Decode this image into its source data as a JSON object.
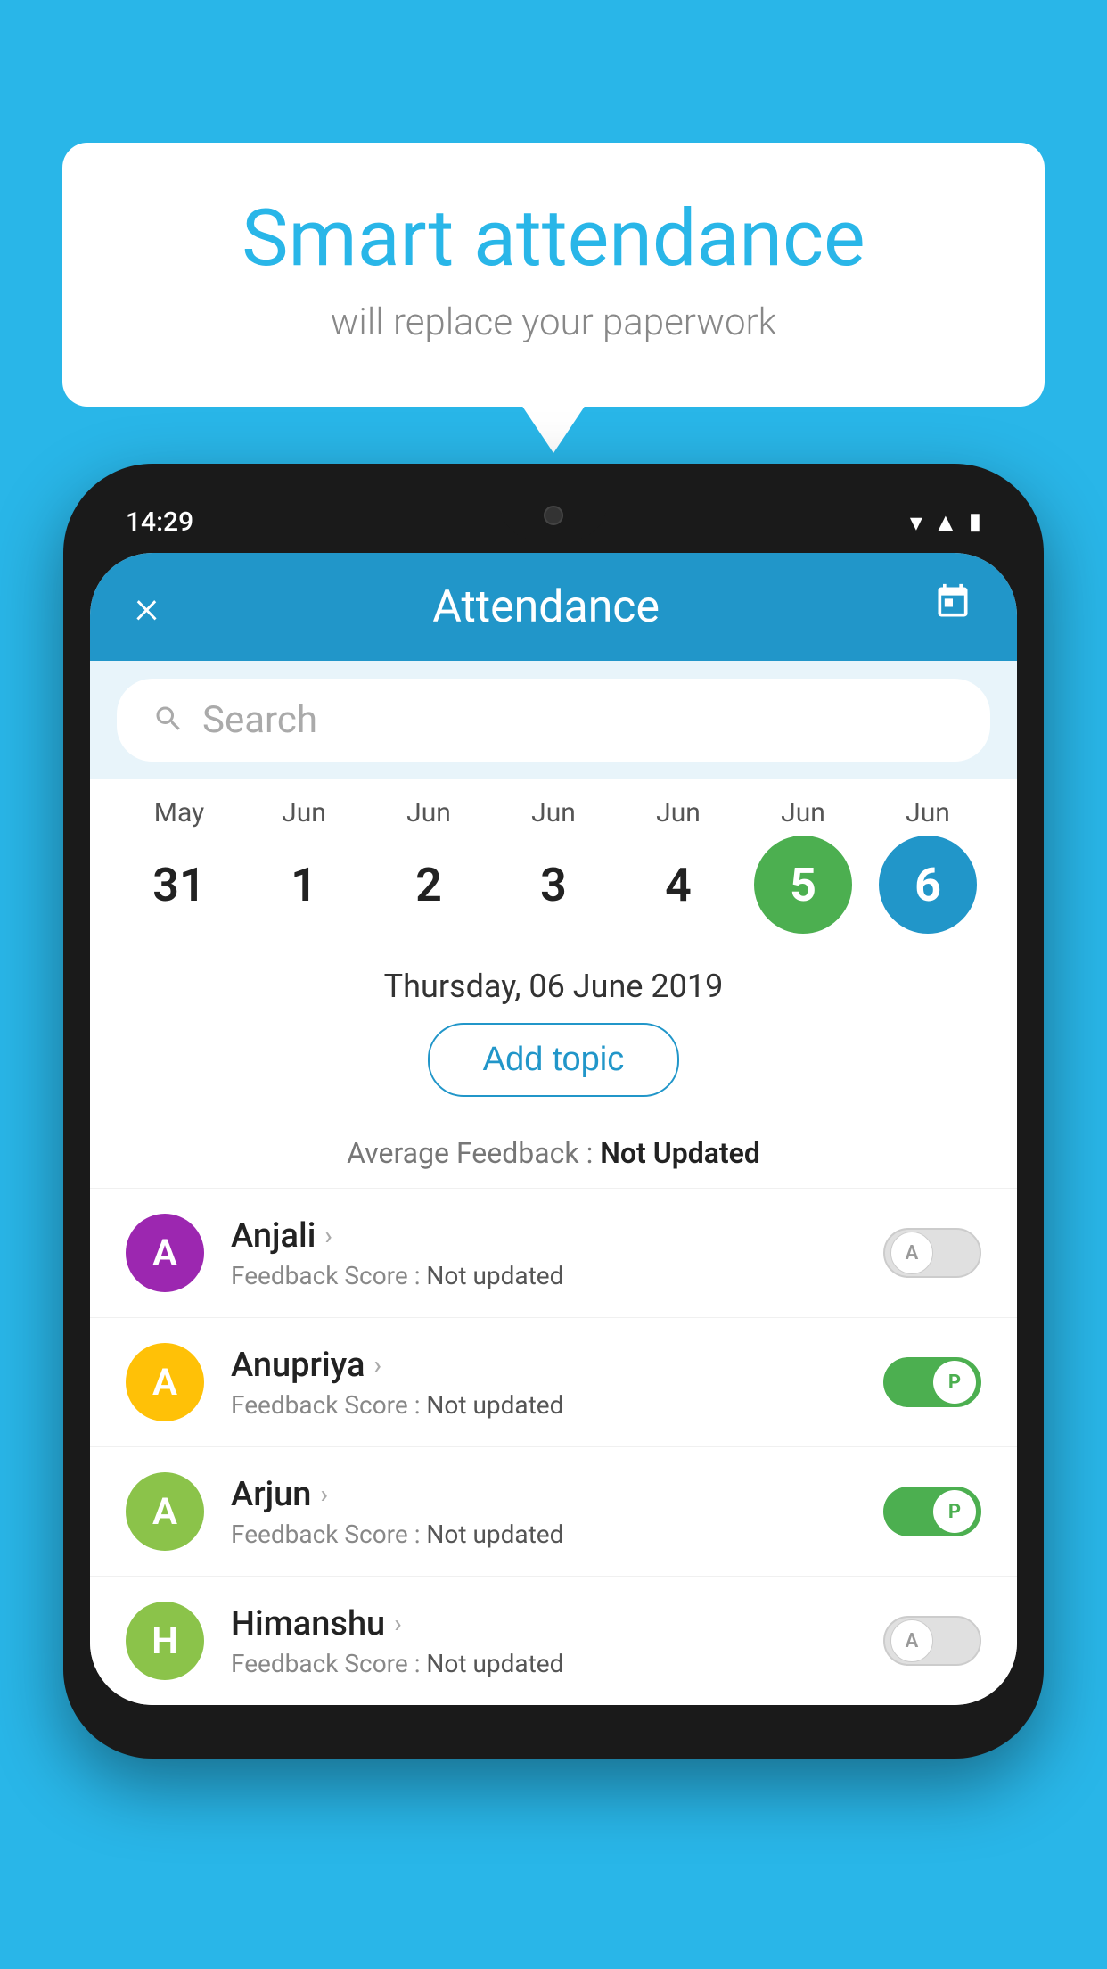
{
  "background_color": "#29b6e8",
  "speech_bubble": {
    "title": "Smart attendance",
    "subtitle": "will replace your paperwork"
  },
  "phone": {
    "status_bar": {
      "time": "14:29"
    },
    "header": {
      "title": "Attendance",
      "close_label": "×",
      "calendar_icon": "📅"
    },
    "search": {
      "placeholder": "Search"
    },
    "calendar": {
      "columns": [
        {
          "month": "May",
          "day": "31",
          "style": "normal"
        },
        {
          "month": "Jun",
          "day": "1",
          "style": "normal"
        },
        {
          "month": "Jun",
          "day": "2",
          "style": "normal"
        },
        {
          "month": "Jun",
          "day": "3",
          "style": "normal"
        },
        {
          "month": "Jun",
          "day": "4",
          "style": "normal"
        },
        {
          "month": "Jun",
          "day": "5",
          "style": "green"
        },
        {
          "month": "Jun",
          "day": "6",
          "style": "blue"
        }
      ]
    },
    "selected_date": "Thursday, 06 June 2019",
    "add_topic_label": "Add topic",
    "feedback_summary": {
      "label": "Average Feedback : ",
      "value": "Not Updated"
    },
    "students": [
      {
        "name": "Anjali",
        "avatar_letter": "A",
        "avatar_color": "#9c27b0",
        "feedback_label": "Feedback Score : ",
        "feedback_value": "Not updated",
        "toggle": "off",
        "toggle_letter": "A"
      },
      {
        "name": "Anupriya",
        "avatar_letter": "A",
        "avatar_color": "#ffc107",
        "feedback_label": "Feedback Score : ",
        "feedback_value": "Not updated",
        "toggle": "on",
        "toggle_letter": "P"
      },
      {
        "name": "Arjun",
        "avatar_letter": "A",
        "avatar_color": "#8bc34a",
        "feedback_label": "Feedback Score : ",
        "feedback_value": "Not updated",
        "toggle": "on",
        "toggle_letter": "P"
      },
      {
        "name": "Himanshu",
        "avatar_letter": "H",
        "avatar_color": "#8bc34a",
        "feedback_label": "Feedback Score : ",
        "feedback_value": "Not updated",
        "toggle": "off",
        "toggle_letter": "A"
      }
    ]
  }
}
